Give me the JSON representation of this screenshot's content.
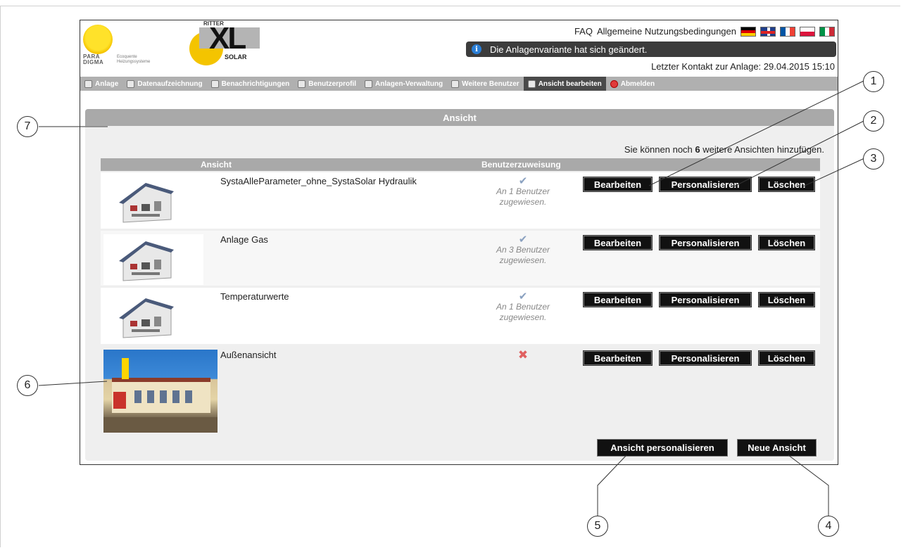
{
  "header": {
    "logo_para_text": "PARA\nDIGMA",
    "logo_para_sub": "Ecoquente\nHeizungssysteme",
    "logo_xl_top": "RITTER",
    "logo_xl_main": "XL",
    "logo_xl_bottom": "SOLAR",
    "faq_label": "FAQ",
    "terms_label": "Allgemeine Nutzungsbedingungen",
    "notice_text": "Die Anlagenvariante hat sich geändert.",
    "last_contact": "Letzter Kontakt zur Anlage: 29.04.2015 15:10",
    "flags": [
      "de-flag-icon",
      "uk-flag-icon",
      "fr-flag-icon",
      "pl-flag-icon",
      "it-flag-icon"
    ]
  },
  "nav": {
    "items": [
      {
        "label": "Anlage",
        "icon": "plant-icon"
      },
      {
        "label": "Datenaufzeichnung",
        "icon": "chart-icon"
      },
      {
        "label": "Benachrichtigungen",
        "icon": "mail-icon"
      },
      {
        "label": "Benutzerprofil",
        "icon": "user-icon"
      },
      {
        "label": "Anlagen-Verwaltung",
        "icon": "tools-icon"
      },
      {
        "label": "Weitere Benutzer",
        "icon": "users-icon"
      },
      {
        "label": "Ansicht bearbeiten",
        "icon": "monitor-icon",
        "active": true
      },
      {
        "label": "Abmelden",
        "icon": "logout-icon"
      }
    ]
  },
  "panel": {
    "title": "Ansicht",
    "info_prefix": "Sie können noch",
    "info_count": "6",
    "info_suffix": "weitere Ansichten hinzufügen.",
    "col_view": "Ansicht",
    "col_assign": "Benutzerzuweisung"
  },
  "rows": [
    {
      "name": "SystaAlleParameter_ohne_SystaSolar Hydraulik",
      "assign_line1": "An 1 Benutzer",
      "assign_line2": "zugewiesen.",
      "assigned": true
    },
    {
      "name": "Anlage Gas",
      "assign_line1": "An 3 Benutzer",
      "assign_line2": "zugewiesen.",
      "assigned": true
    },
    {
      "name": "Temperaturwerte",
      "assign_line1": "An 1 Benutzer",
      "assign_line2": "zugewiesen.",
      "assigned": true
    },
    {
      "name": "Außenansicht",
      "assign_line1": "",
      "assign_line2": "",
      "assigned": false
    }
  ],
  "buttons": {
    "edit": "Bearbeiten",
    "personalize": "Personalisieren",
    "delete": "Löschen",
    "personalize_view": "Ansicht personalisieren",
    "new_view": "Neue Ansicht"
  },
  "callouts": [
    "1",
    "2",
    "3",
    "4",
    "5",
    "6",
    "7"
  ],
  "colors": {
    "nav_bg": "#b0b0b0",
    "nav_active": "#4a4a4a",
    "button_bg": "#111111",
    "notice_bg": "#3c3c3c",
    "accent_yellow": "#f4c400"
  }
}
